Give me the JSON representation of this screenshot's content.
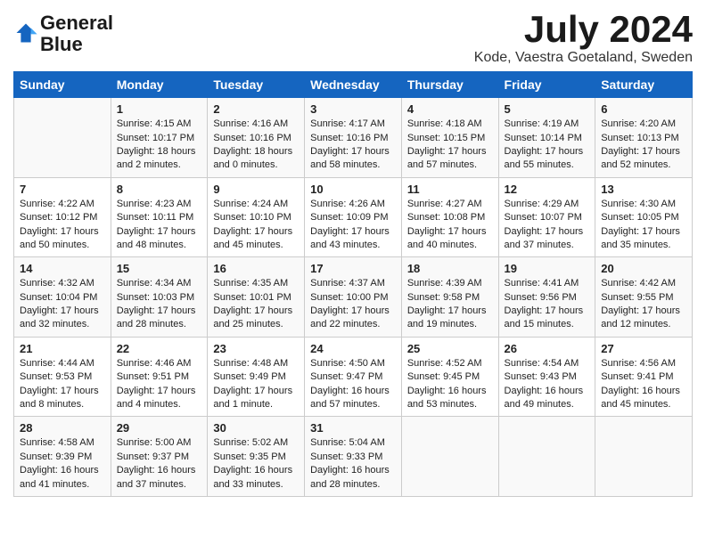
{
  "logo": {
    "text_general": "General",
    "text_blue": "Blue"
  },
  "header": {
    "month_year": "July 2024",
    "location": "Kode, Vaestra Goetaland, Sweden"
  },
  "days_of_week": [
    "Sunday",
    "Monday",
    "Tuesday",
    "Wednesday",
    "Thursday",
    "Friday",
    "Saturday"
  ],
  "weeks": [
    [
      {
        "day": "",
        "info": ""
      },
      {
        "day": "1",
        "info": "Sunrise: 4:15 AM\nSunset: 10:17 PM\nDaylight: 18 hours\nand 2 minutes."
      },
      {
        "day": "2",
        "info": "Sunrise: 4:16 AM\nSunset: 10:16 PM\nDaylight: 18 hours\nand 0 minutes."
      },
      {
        "day": "3",
        "info": "Sunrise: 4:17 AM\nSunset: 10:16 PM\nDaylight: 17 hours\nand 58 minutes."
      },
      {
        "day": "4",
        "info": "Sunrise: 4:18 AM\nSunset: 10:15 PM\nDaylight: 17 hours\nand 57 minutes."
      },
      {
        "day": "5",
        "info": "Sunrise: 4:19 AM\nSunset: 10:14 PM\nDaylight: 17 hours\nand 55 minutes."
      },
      {
        "day": "6",
        "info": "Sunrise: 4:20 AM\nSunset: 10:13 PM\nDaylight: 17 hours\nand 52 minutes."
      }
    ],
    [
      {
        "day": "7",
        "info": "Sunrise: 4:22 AM\nSunset: 10:12 PM\nDaylight: 17 hours\nand 50 minutes."
      },
      {
        "day": "8",
        "info": "Sunrise: 4:23 AM\nSunset: 10:11 PM\nDaylight: 17 hours\nand 48 minutes."
      },
      {
        "day": "9",
        "info": "Sunrise: 4:24 AM\nSunset: 10:10 PM\nDaylight: 17 hours\nand 45 minutes."
      },
      {
        "day": "10",
        "info": "Sunrise: 4:26 AM\nSunset: 10:09 PM\nDaylight: 17 hours\nand 43 minutes."
      },
      {
        "day": "11",
        "info": "Sunrise: 4:27 AM\nSunset: 10:08 PM\nDaylight: 17 hours\nand 40 minutes."
      },
      {
        "day": "12",
        "info": "Sunrise: 4:29 AM\nSunset: 10:07 PM\nDaylight: 17 hours\nand 37 minutes."
      },
      {
        "day": "13",
        "info": "Sunrise: 4:30 AM\nSunset: 10:05 PM\nDaylight: 17 hours\nand 35 minutes."
      }
    ],
    [
      {
        "day": "14",
        "info": "Sunrise: 4:32 AM\nSunset: 10:04 PM\nDaylight: 17 hours\nand 32 minutes."
      },
      {
        "day": "15",
        "info": "Sunrise: 4:34 AM\nSunset: 10:03 PM\nDaylight: 17 hours\nand 28 minutes."
      },
      {
        "day": "16",
        "info": "Sunrise: 4:35 AM\nSunset: 10:01 PM\nDaylight: 17 hours\nand 25 minutes."
      },
      {
        "day": "17",
        "info": "Sunrise: 4:37 AM\nSunset: 10:00 PM\nDaylight: 17 hours\nand 22 minutes."
      },
      {
        "day": "18",
        "info": "Sunrise: 4:39 AM\nSunset: 9:58 PM\nDaylight: 17 hours\nand 19 minutes."
      },
      {
        "day": "19",
        "info": "Sunrise: 4:41 AM\nSunset: 9:56 PM\nDaylight: 17 hours\nand 15 minutes."
      },
      {
        "day": "20",
        "info": "Sunrise: 4:42 AM\nSunset: 9:55 PM\nDaylight: 17 hours\nand 12 minutes."
      }
    ],
    [
      {
        "day": "21",
        "info": "Sunrise: 4:44 AM\nSunset: 9:53 PM\nDaylight: 17 hours\nand 8 minutes."
      },
      {
        "day": "22",
        "info": "Sunrise: 4:46 AM\nSunset: 9:51 PM\nDaylight: 17 hours\nand 4 minutes."
      },
      {
        "day": "23",
        "info": "Sunrise: 4:48 AM\nSunset: 9:49 PM\nDaylight: 17 hours\nand 1 minute."
      },
      {
        "day": "24",
        "info": "Sunrise: 4:50 AM\nSunset: 9:47 PM\nDaylight: 16 hours\nand 57 minutes."
      },
      {
        "day": "25",
        "info": "Sunrise: 4:52 AM\nSunset: 9:45 PM\nDaylight: 16 hours\nand 53 minutes."
      },
      {
        "day": "26",
        "info": "Sunrise: 4:54 AM\nSunset: 9:43 PM\nDaylight: 16 hours\nand 49 minutes."
      },
      {
        "day": "27",
        "info": "Sunrise: 4:56 AM\nSunset: 9:41 PM\nDaylight: 16 hours\nand 45 minutes."
      }
    ],
    [
      {
        "day": "28",
        "info": "Sunrise: 4:58 AM\nSunset: 9:39 PM\nDaylight: 16 hours\nand 41 minutes."
      },
      {
        "day": "29",
        "info": "Sunrise: 5:00 AM\nSunset: 9:37 PM\nDaylight: 16 hours\nand 37 minutes."
      },
      {
        "day": "30",
        "info": "Sunrise: 5:02 AM\nSunset: 9:35 PM\nDaylight: 16 hours\nand 33 minutes."
      },
      {
        "day": "31",
        "info": "Sunrise: 5:04 AM\nSunset: 9:33 PM\nDaylight: 16 hours\nand 28 minutes."
      },
      {
        "day": "",
        "info": ""
      },
      {
        "day": "",
        "info": ""
      },
      {
        "day": "",
        "info": ""
      }
    ]
  ]
}
